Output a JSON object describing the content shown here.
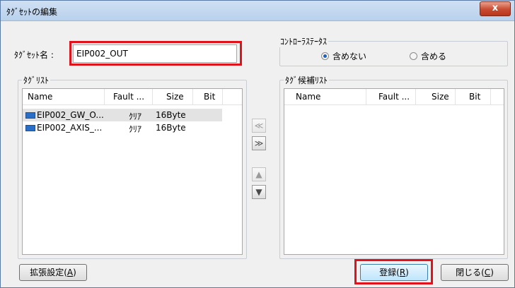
{
  "window": {
    "title": "ﾀｸﾞｾｯﾄの編集",
    "close_label": "x"
  },
  "tagset": {
    "name_label": "ﾀｸﾞｾｯﾄ名 :",
    "name_value": "EIP002_OUT"
  },
  "controller_status": {
    "title": "ｺﾝﾄﾛｰﾗｽﾃｰﾀｽ",
    "options": [
      {
        "label": "含めない",
        "checked": true
      },
      {
        "label": "含める",
        "checked": false
      }
    ]
  },
  "tag_list": {
    "title": "ﾀｸﾞﾘｽﾄ",
    "columns": [
      "Name",
      "Fault ...",
      "Size",
      "Bit"
    ],
    "rows": [
      {
        "name": "EIP002_GW_O...",
        "fault": "ｸﾘｱ",
        "size": "16Byte",
        "bit": "",
        "selected": true
      },
      {
        "name": "EIP002_AXIS_...",
        "fault": "ｸﾘｱ",
        "size": "16Byte",
        "bit": "",
        "selected": false
      }
    ]
  },
  "candidate_list": {
    "title": "ﾀｸﾞ候補ﾘｽﾄ",
    "columns": [
      "Name",
      "Fault ...",
      "Size",
      "Bit"
    ],
    "rows": []
  },
  "transfer_buttons": {
    "move_left": "≪",
    "move_right": "≫",
    "move_up": "▲",
    "move_down": "▼"
  },
  "footer": {
    "extended_settings": {
      "text": "拡張設定(",
      "key": "A",
      "tail": ")"
    },
    "register": {
      "text": "登録(",
      "key": "R",
      "tail": ")"
    },
    "close": {
      "text": "閉じる(",
      "key": "C",
      "tail": ")"
    }
  }
}
